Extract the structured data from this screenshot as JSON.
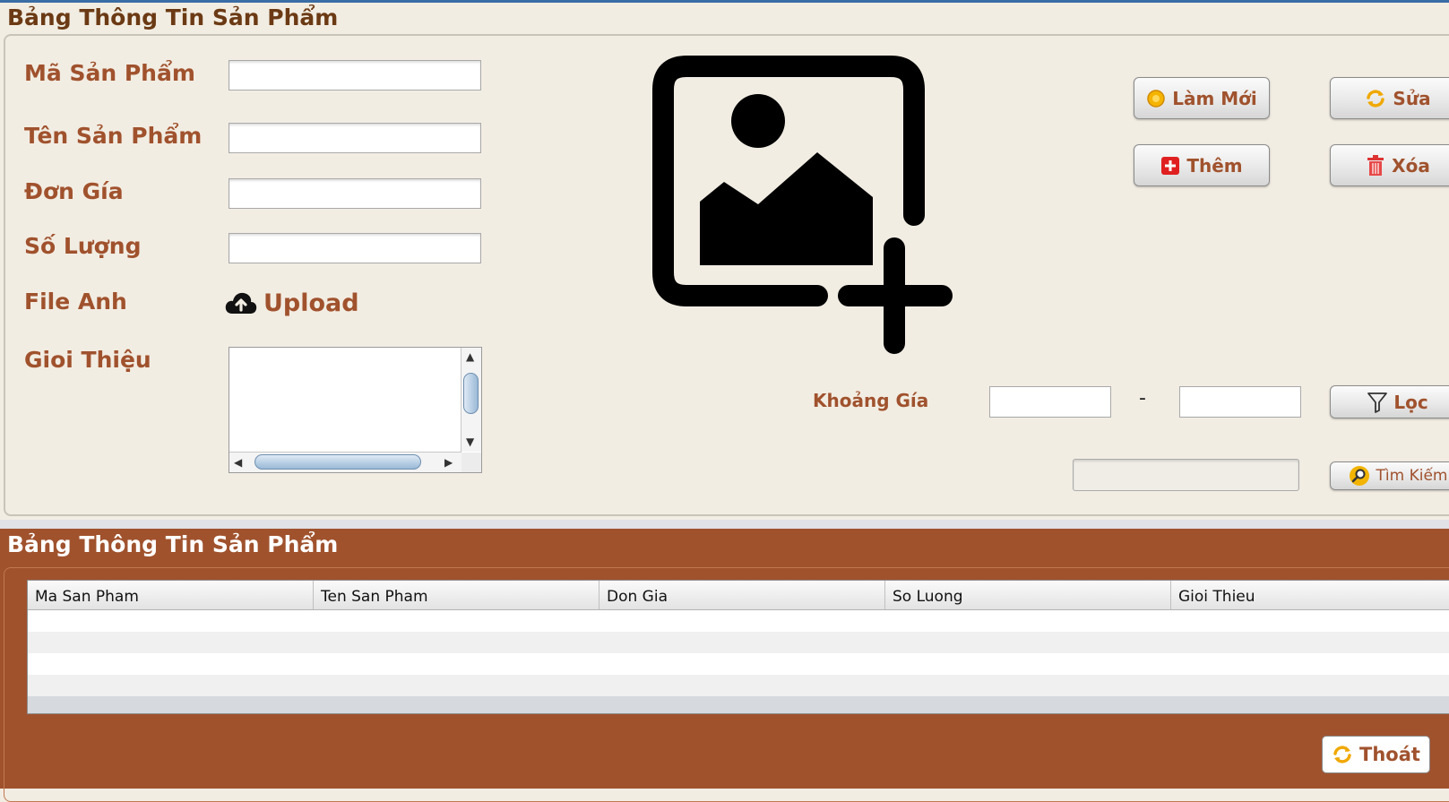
{
  "top_panel": {
    "title": "Bảng Thông Tin Sản Phẩm"
  },
  "form": {
    "labels": {
      "ma_san_pham": "Mã Sản Phẩm",
      "ten_san_pham": "Tên Sản Phẩm",
      "don_gia": "Đơn Gía",
      "so_luong": "Số Lượng",
      "file_anh": "File Anh",
      "gioi_thieu": "Gioi Thiệu"
    },
    "values": {
      "ma_san_pham": "",
      "ten_san_pham": "",
      "don_gia": "",
      "so_luong": "",
      "gioi_thieu": ""
    },
    "upload_label": "Upload",
    "upload_icon": "cloud-upload-icon",
    "image_placeholder_icon": "add-image-icon"
  },
  "actions": {
    "lam_moi": "Làm Mới",
    "sua": "Sửa",
    "them": "Thêm",
    "xoa": "Xóa"
  },
  "filter": {
    "label": "Khoảng Gía",
    "separator": "-",
    "min_value": "",
    "max_value": "",
    "loc_button": "Lọc",
    "search_value": "",
    "tim_kiem_button": "Tìm Kiếm"
  },
  "bottom_panel": {
    "title": "Bảng Thông Tin Sản Phẩm"
  },
  "table": {
    "columns": [
      "Ma San Pham",
      "Ten San Pham",
      "Don Gia",
      "So Luong",
      "Gioi Thieu"
    ],
    "rows": []
  },
  "footer": {
    "thoat_button": "Thoát"
  },
  "colors": {
    "brown_label": "#a0522d",
    "panel_bg": "#f2ede3",
    "bottom_bg": "#a0522d",
    "title_dark": "#6b3a14"
  }
}
